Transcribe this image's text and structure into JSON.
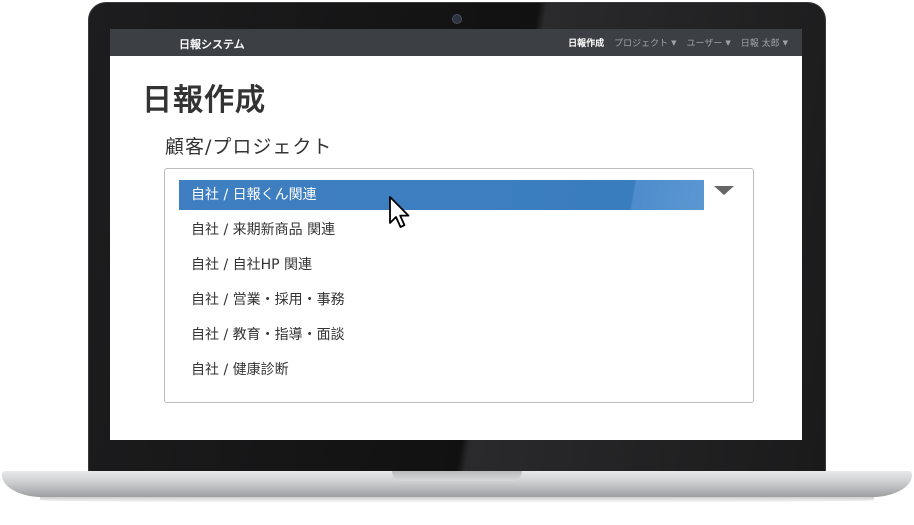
{
  "navbar": {
    "brand": "日報システム",
    "items": [
      {
        "label": "日報作成",
        "active": true,
        "dropdown": false
      },
      {
        "label": "プロジェクト",
        "active": false,
        "dropdown": true
      },
      {
        "label": "ユーザー",
        "active": false,
        "dropdown": true
      },
      {
        "label": "日報 太郎",
        "active": false,
        "dropdown": true
      }
    ]
  },
  "page": {
    "title": "日報作成",
    "field_label": "顧客/プロジェクト"
  },
  "select": {
    "selected_index": 0,
    "options": [
      "自社 / 日報くん関連",
      "自社 / 来期新商品 関連",
      "自社 / 自社HP 関連",
      "自社 / 営業・採用・事務",
      "自社 / 教育・指導・面談",
      "自社 / 健康診断"
    ]
  },
  "colors": {
    "navbar_bg": "#3c4045",
    "selected_bg": "#3a7dbf"
  },
  "icons": {
    "dropdown_arrow": "triangle-down",
    "cursor": "arrow-pointer"
  }
}
